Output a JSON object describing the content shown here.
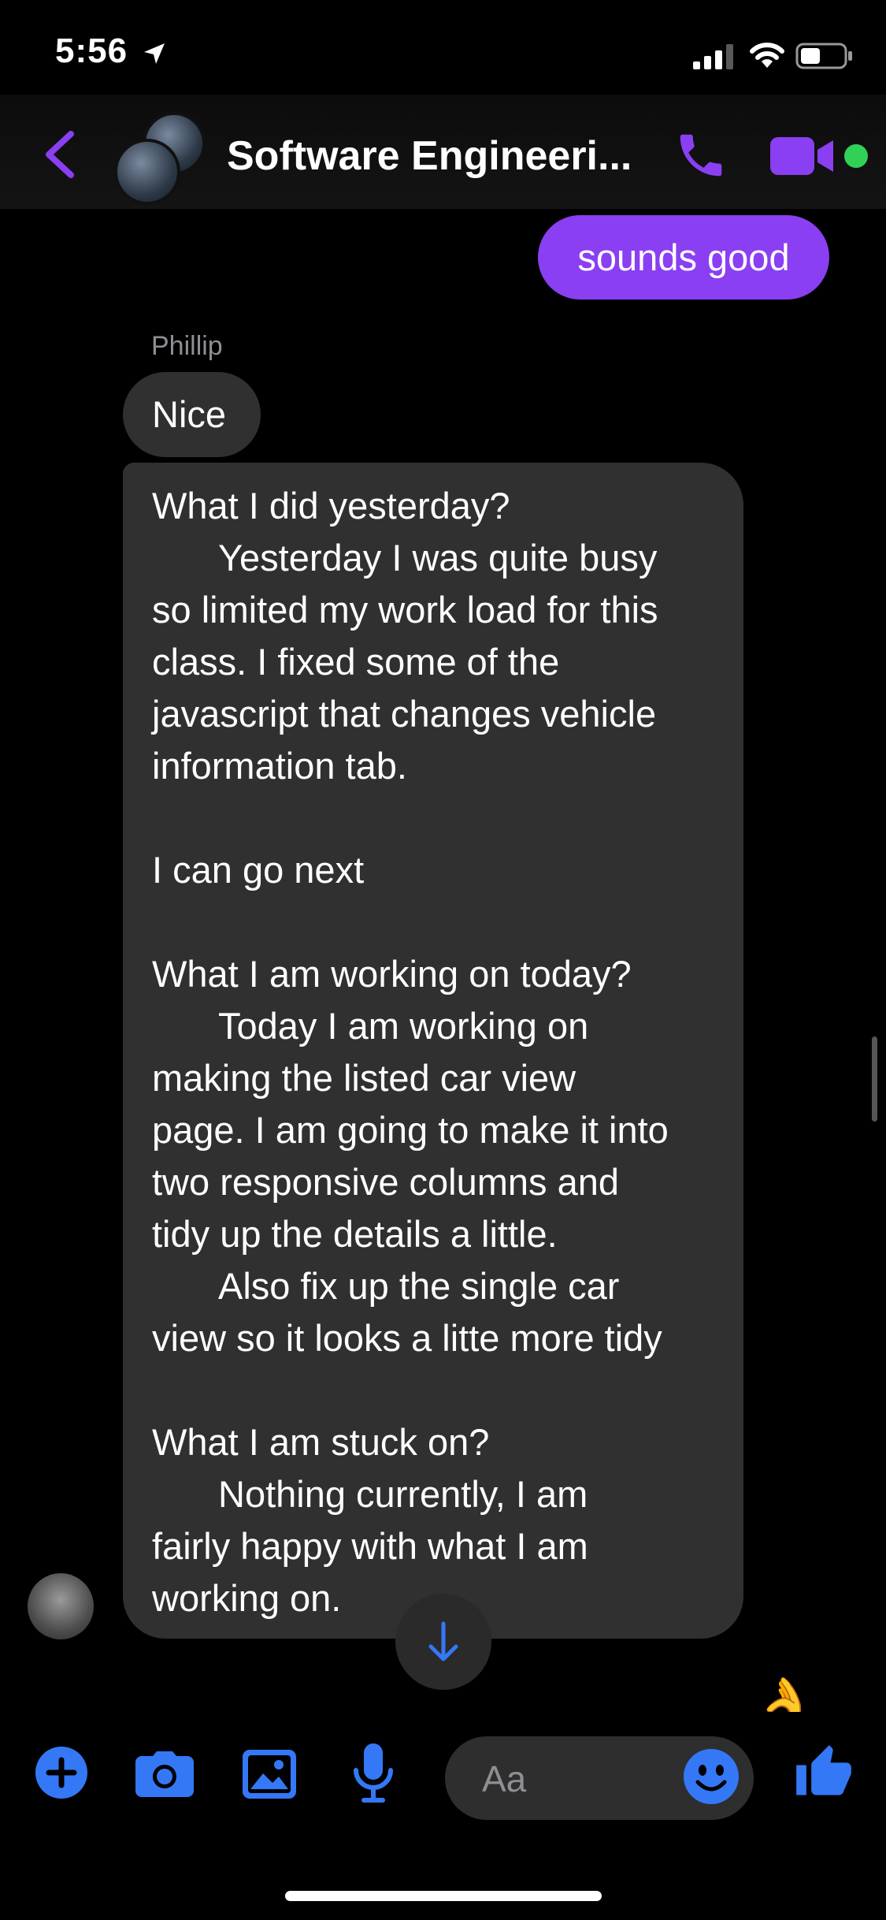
{
  "status_bar": {
    "time": "5:56"
  },
  "header": {
    "title": "Software Engineeri..."
  },
  "colors": {
    "accent_purple": "#8a3ff2",
    "bubble_gray": "#303030",
    "icon_blue": "#3478f6",
    "online_green": "#31d158"
  },
  "messages": {
    "sent_text": "sounds good",
    "sender_name": "Phillip",
    "nice_text": "Nice",
    "long_lines": [
      "What I did yesterday?",
      "Yesterday I was quite busy",
      "so limited my work load for this",
      "class. I fixed some of the",
      "javascript that changes vehicle",
      "information tab.",
      "",
      "I can go next",
      "",
      "What I am working on today?",
      "Today I am working on",
      "making the listed car view",
      "page. I am going to make it into",
      "two responsive columns and",
      "tidy up the details a little.",
      "Also fix up the single car",
      "view so it looks a litte more tidy",
      "",
      "What I am stuck on?",
      "Nothing currently, I am",
      "fairly happy with what I am",
      "working on."
    ]
  },
  "reaction": "👌",
  "composer": {
    "placeholder": "Aa"
  },
  "icons": [
    "back-chevron-icon",
    "phone-icon",
    "video-camera-icon",
    "plus-icon",
    "camera-icon",
    "photo-icon",
    "microphone-icon",
    "smiley-icon",
    "thumbs-up-icon",
    "down-arrow-icon",
    "location-arrow-icon",
    "signal-icon",
    "wifi-icon",
    "battery-icon"
  ]
}
